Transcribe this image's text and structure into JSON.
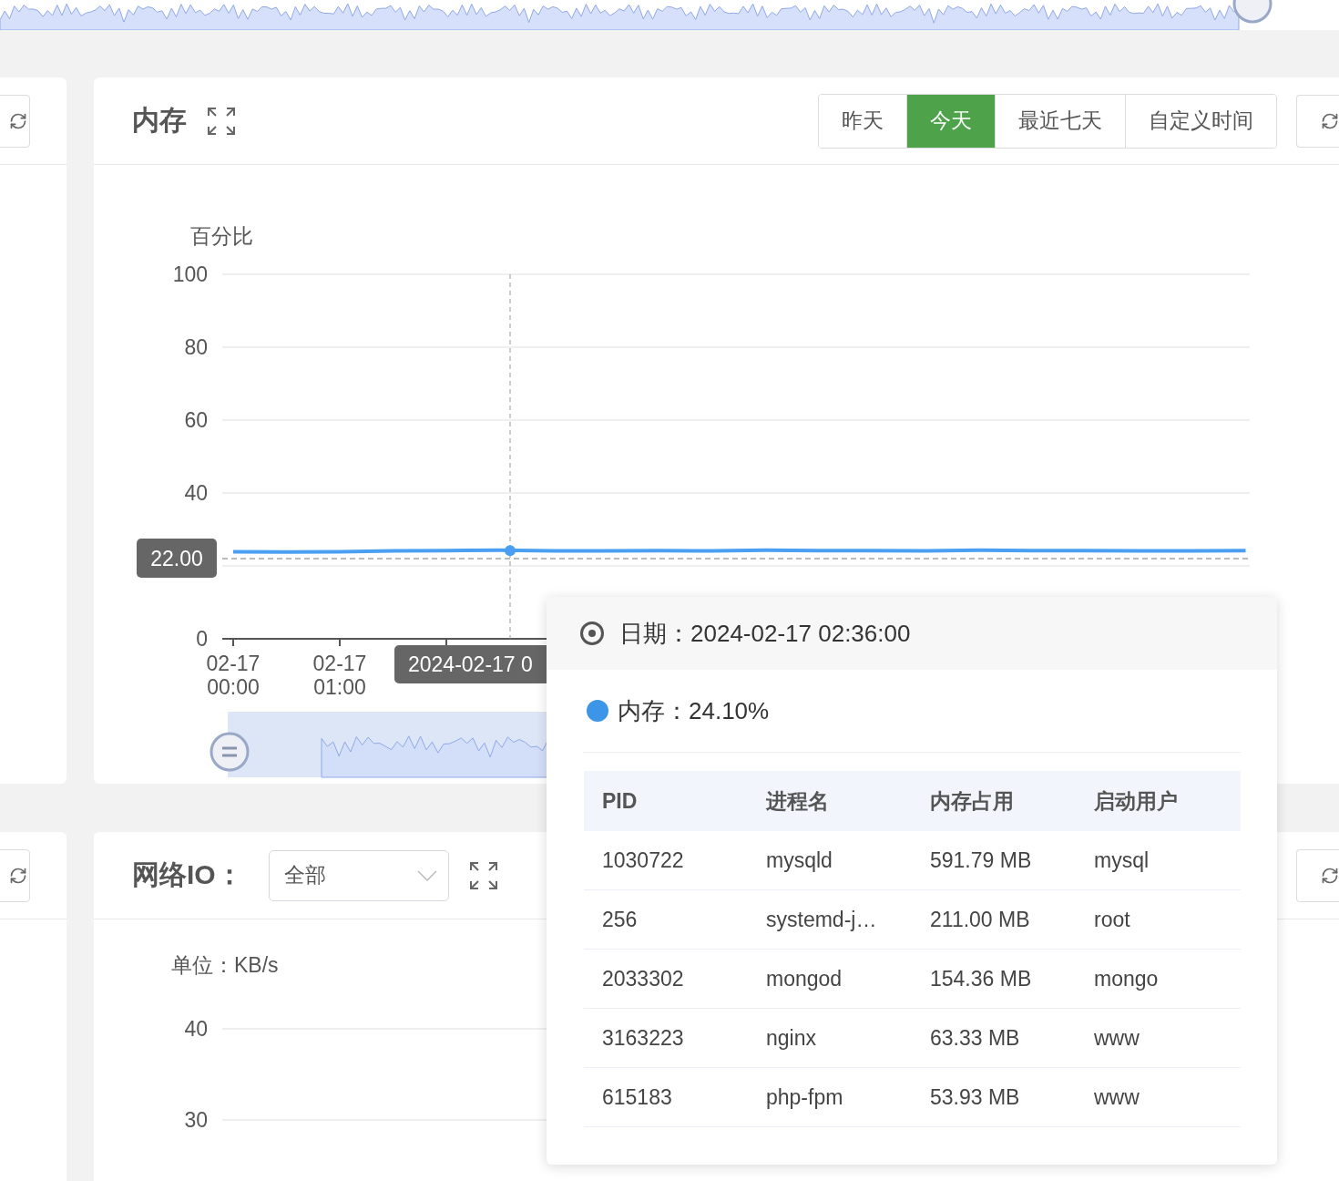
{
  "memory_panel": {
    "title": "内存",
    "range_buttons": [
      {
        "label": "昨天",
        "selected": false
      },
      {
        "label": "今天",
        "selected": true
      },
      {
        "label": "最近七天",
        "selected": false
      },
      {
        "label": "自定义时间",
        "selected": false
      }
    ],
    "chart": {
      "x_pointer_label": "2024-02-17 0",
      "chart_data": {
        "type": "line",
        "ylabel": "百分比",
        "ylim": [
          0,
          100
        ],
        "grid": true,
        "ref_lines": [
          {
            "axis": "y",
            "value": 22,
            "label": "22.00"
          }
        ],
        "yticks": [
          0,
          40,
          60,
          80,
          100
        ],
        "categories": [
          "02-17 00:00",
          null,
          "02-17 01:00",
          null,
          null,
          null,
          null,
          null,
          null,
          null,
          null,
          null,
          null,
          null,
          null,
          null,
          null,
          null,
          null,
          null
        ],
        "series": [
          {
            "color": "#4b9ff2",
            "values": [
              23.9,
              23.8,
              23.9,
              24.1,
              24.2,
              24.3,
              24.1,
              24.1,
              24.2,
              24.1,
              24.3,
              24.2,
              24.2,
              24.1,
              24.3,
              24.2,
              24.2,
              24.1,
              24.1,
              24.2
            ]
          }
        ]
      }
    }
  },
  "network_panel": {
    "title": "网络IO：",
    "select": {
      "value": "全部"
    },
    "chart": {
      "unit_label": "单位：KB/s",
      "y_ticks": [
        "40",
        "30"
      ]
    }
  },
  "tooltip": {
    "date": "日期：2024-02-17 02:36:00",
    "series_line": "内存：24.10%",
    "table": {
      "columns": [
        "PID",
        "进程名",
        "内存占用",
        "启动用户"
      ],
      "rows": [
        [
          "1030722",
          "mysqld",
          "591.79 MB",
          "mysql"
        ],
        [
          "256",
          "systemd-j…",
          "211.00 MB",
          "root"
        ],
        [
          "2033302",
          "mongod",
          "154.36 MB",
          "mongo"
        ],
        [
          "3163223",
          "nginx",
          "63.33 MB",
          "www"
        ],
        [
          "615183",
          "php-fpm",
          "53.93 MB",
          "www"
        ]
      ]
    }
  }
}
